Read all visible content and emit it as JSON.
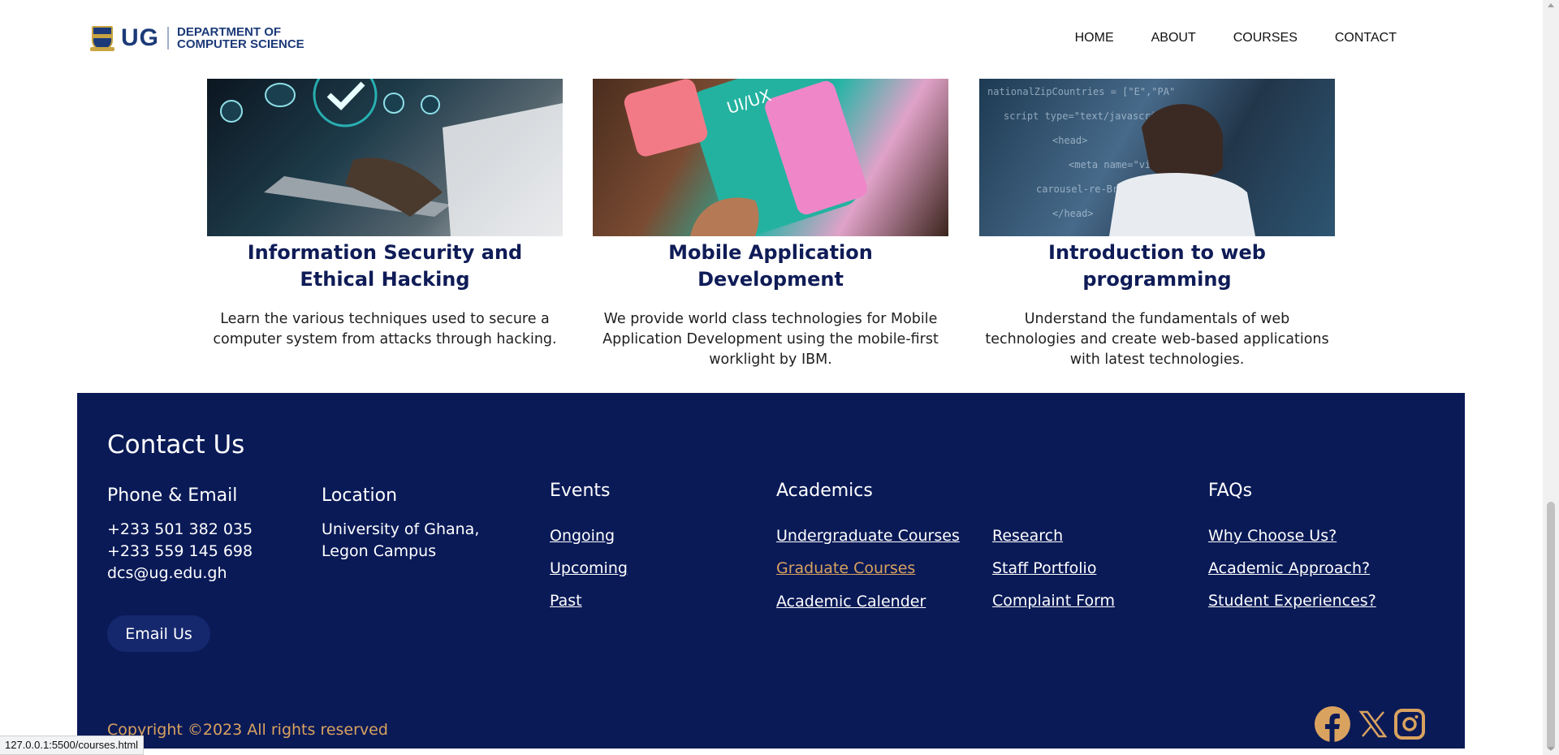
{
  "header": {
    "logo_short": "UG",
    "logo_line1": "DEPARTMENT OF",
    "logo_line2": "COMPUTER SCIENCE",
    "nav": [
      "HOME",
      "ABOUT",
      "COURSES",
      "CONTACT"
    ]
  },
  "courses": [
    {
      "title": "Information Security and Ethical Hacking",
      "description": "Learn the various techniques used to secure a computer system from attacks through hacking."
    },
    {
      "title": "Mobile Application Development",
      "description": "We provide world class technologies for Mobile Application Development using the mobile-first worklight by IBM."
    },
    {
      "title": "Introduction to web programming",
      "description": "Understand the fundamentals of web technologies and create web-based applications with latest technologies."
    }
  ],
  "footer": {
    "title": "Contact Us",
    "phone_email_heading": "Phone & Email",
    "phone1": "+233 501 382 035",
    "phone2": "+233 559 145 698",
    "email": "dcs@ug.edu.gh",
    "email_button": "Email Us",
    "location_heading": "Location",
    "location_line1": "University of Ghana,",
    "location_line2": "Legon Campus",
    "events_heading": "Events",
    "events": [
      "Ongoing",
      "Upcoming",
      "Past"
    ],
    "academics_heading": "Academics",
    "academics_col1": [
      "Undergraduate Courses",
      "Graduate Courses",
      "Academic Calender"
    ],
    "academics_col2": [
      "Research",
      "Staff Portfolio",
      "Complaint Form"
    ],
    "faqs_heading": "FAQs",
    "faqs": [
      "Why Choose Us?",
      "Academic Approach?",
      "Student Experiences?"
    ],
    "copyright": "Copyright ©2023 All rights reserved",
    "social_icons": [
      "facebook-icon",
      "x-icon",
      "instagram-icon"
    ]
  },
  "status_url": "127.0.0.1:5500/courses.html",
  "colors": {
    "navy": "#0a1a57",
    "heading_navy": "#0f1c57",
    "gold": "#d9a25f"
  }
}
